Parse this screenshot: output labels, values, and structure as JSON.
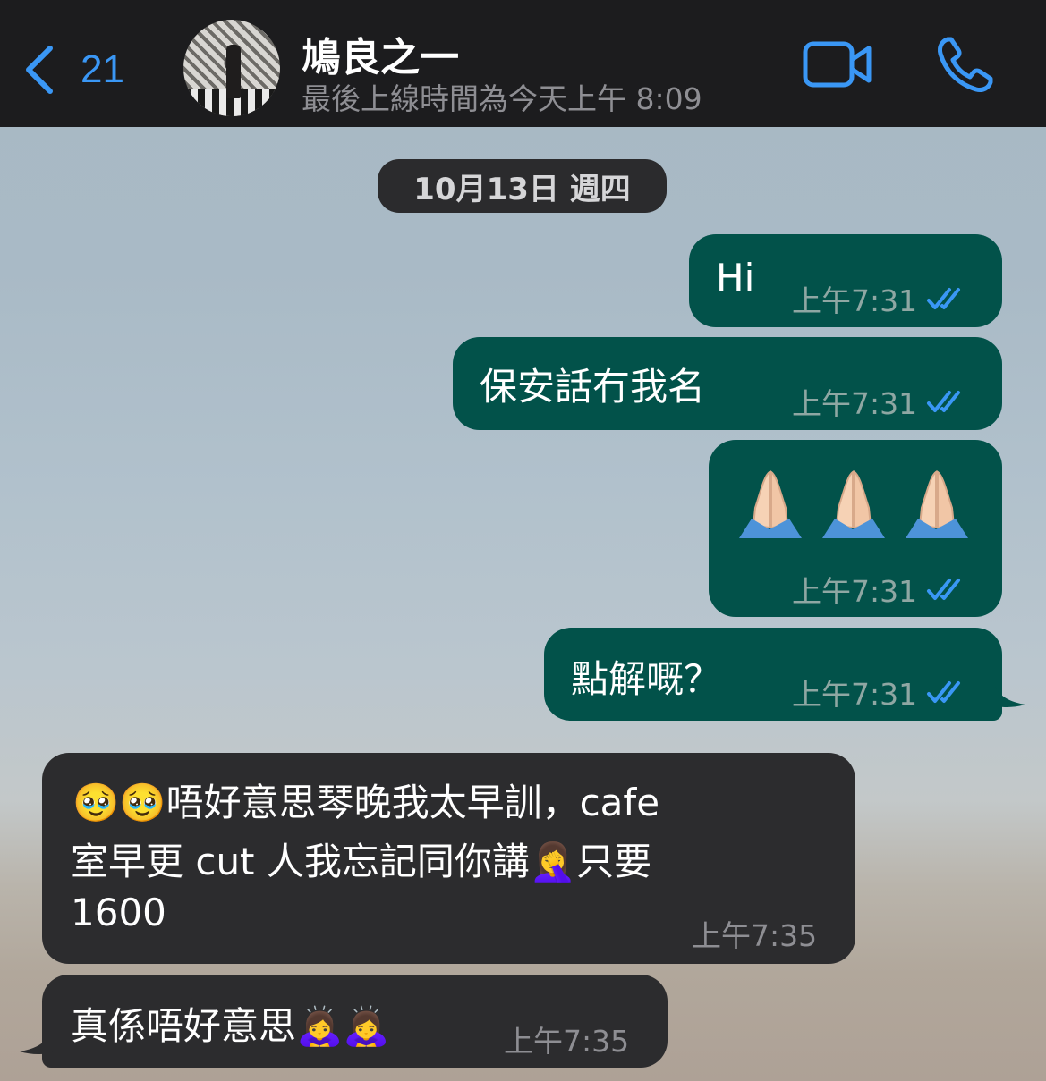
{
  "header": {
    "back_count": "21",
    "contact_name": "鳩良之一",
    "last_seen": "最後上線時間為今天上午 8:09",
    "video_icon": "video-camera-icon",
    "call_icon": "phone-icon",
    "accent_color": "#3a97f5"
  },
  "date_separator": "10月13日 週四",
  "messages": [
    {
      "direction": "out",
      "text": "Hi",
      "time": "上午7:31",
      "status": "read"
    },
    {
      "direction": "out",
      "text": "保安話冇我名",
      "time": "上午7:31",
      "status": "read"
    },
    {
      "direction": "out",
      "text": "🙏🏻🙏🏻🙏🏻",
      "time": "上午7:31",
      "status": "read"
    },
    {
      "direction": "out",
      "text": "點解嘅？",
      "time": "上午7:31",
      "status": "read"
    },
    {
      "direction": "in",
      "lines": [
        "🥹🥹唔好意思琴晚我太早訓，cafe",
        "室早更 cut 人我忘記同你講🤦‍♀️只要",
        "1600"
      ],
      "time": "上午7:35"
    },
    {
      "direction": "in",
      "text": "真係唔好意思🙇‍♀️🙇‍♀️",
      "time": "上午7:35"
    }
  ],
  "colors": {
    "outgoing_bubble": "#02524a",
    "incoming_bubble": "#2c2c2e",
    "read_ticks": "#3a97f5"
  }
}
